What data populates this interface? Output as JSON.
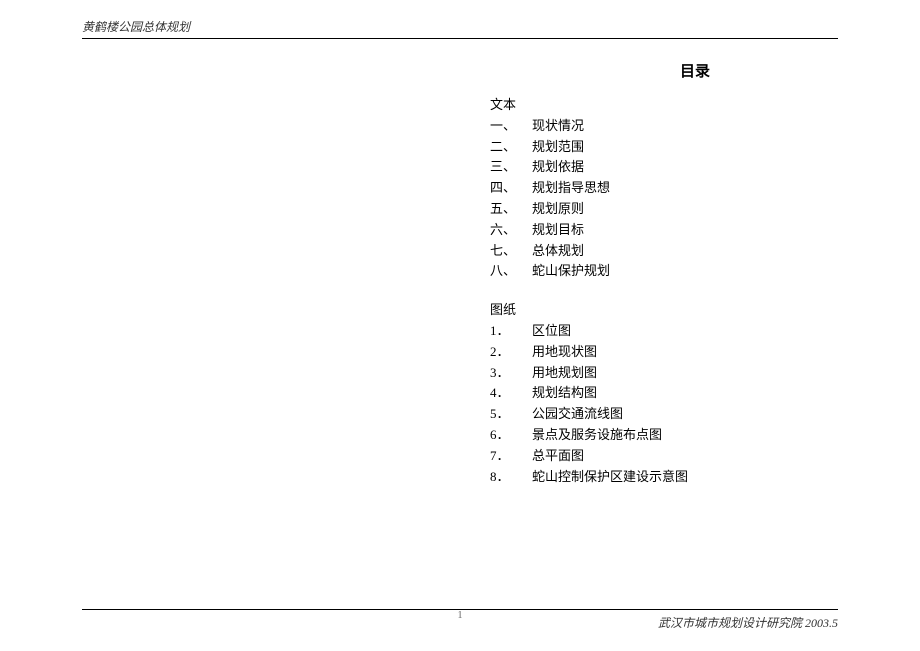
{
  "header": {
    "doc_title": "黄鹤楼公园总体规划"
  },
  "title": "目录",
  "section1": {
    "label": "文本",
    "items": [
      {
        "marker": "一、",
        "text": "现状情况"
      },
      {
        "marker": "二、",
        "text": "规划范围"
      },
      {
        "marker": "三、",
        "text": "规划依据"
      },
      {
        "marker": "四、",
        "text": "规划指导思想"
      },
      {
        "marker": "五、",
        "text": "规划原则"
      },
      {
        "marker": "六、",
        "text": "规划目标"
      },
      {
        "marker": "七、",
        "text": "总体规划"
      },
      {
        "marker": "八、",
        "text": "蛇山保护规划"
      }
    ]
  },
  "section2": {
    "label": "图纸",
    "items": [
      {
        "marker": "1．",
        "text": "区位图"
      },
      {
        "marker": "2．",
        "text": "用地现状图"
      },
      {
        "marker": "3．",
        "text": "用地规划图"
      },
      {
        "marker": "4．",
        "text": "规划结构图"
      },
      {
        "marker": "5．",
        "text": "公园交通流线图"
      },
      {
        "marker": "6．",
        "text": "景点及服务设施布点图"
      },
      {
        "marker": "7．",
        "text": "总平面图"
      },
      {
        "marker": "8．",
        "text": "蛇山控制保护区建设示意图"
      }
    ]
  },
  "footer": {
    "org_date": "武汉市城市规划设计研究院 2003.5"
  },
  "page_number": "1"
}
